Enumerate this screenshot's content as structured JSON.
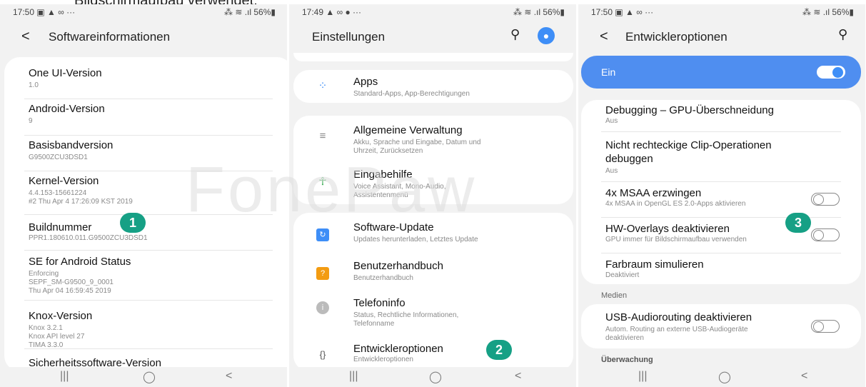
{
  "caption": "Bildschirmaufbau verwendet.",
  "watermark": "FonePaw",
  "panel1": {
    "status_left": "17:50 ▣ ▲ ∞ ···",
    "status_right": "⁂ ≋ .ıl 56%▮",
    "title": "Softwareinformationen",
    "items": [
      {
        "title": "One UI-Version",
        "sub": "1.0"
      },
      {
        "title": "Android-Version",
        "sub": "9"
      },
      {
        "title": "Basisbandversion",
        "sub": "G9500ZCU3DSD1"
      },
      {
        "title": "Kernel-Version",
        "sub": "4.4.153-15661224\n#2 Thu Apr 4 17:26:09 KST 2019"
      },
      {
        "title": "Buildnummer",
        "sub": "PPR1.180610.011.G9500ZCU3DSD1"
      },
      {
        "title": "SE for Android Status",
        "sub": "Enforcing\nSEPF_SM-G9500_9_0001\nThu Apr 04 16:59:45 2019"
      },
      {
        "title": "Knox-Version",
        "sub": "Knox 3.2.1\nKnox API level 27\nTIMA 3.3.0"
      },
      {
        "title": "Sicherheitssoftware-Version",
        "sub": ""
      }
    ],
    "badge": "1"
  },
  "panel2": {
    "status_left": "17:49 ▲ ∞ ● ···",
    "status_right": "⁂ ≋ .ıl 56%▮",
    "title": "Einstellungen",
    "items": [
      {
        "title": "Apps",
        "sub": "Standard-Apps, App-Berechtigungen",
        "icon": "apps-icon"
      },
      {
        "title": "Allgemeine Verwaltung",
        "sub": "Akku, Sprache und Eingabe, Datum und\nUhrzeit, Zurücksetzen",
        "icon": "sliders-icon"
      },
      {
        "title": "Eingabehilfe",
        "sub": "Voice Assistant, Mono-Audio,\nAssistentenmenü",
        "icon": "accessibility-icon"
      },
      {
        "title": "Software-Update",
        "sub": "Updates herunterladen, Letztes Update",
        "icon": "update-icon"
      },
      {
        "title": "Benutzerhandbuch",
        "sub": "Benutzerhandbuch",
        "icon": "help-icon"
      },
      {
        "title": "Telefoninfo",
        "sub": "Status, Rechtliche Informationen,\nTelefonname",
        "icon": "info-icon"
      },
      {
        "title": "Entwickleroptionen",
        "sub": "Entwickleroptionen",
        "icon": "braces-icon"
      }
    ],
    "badge": "2"
  },
  "panel3": {
    "status_left": "17:50 ▣ ▲ ∞ ···",
    "status_right": "⁂ ≋ .ıl 56%▮",
    "title": "Entwickleroptionen",
    "master_label": "Ein",
    "items": [
      {
        "title": "Debugging – GPU-Überschneidung",
        "sub": "Aus"
      },
      {
        "title": "Nicht rechteckige Clip-Operationen\ndebuggen",
        "sub": "Aus"
      },
      {
        "title": "4x MSAA erzwingen",
        "sub": "4x MSAA in OpenGL ES 2.0-Apps aktivieren"
      },
      {
        "title": "HW-Overlays deaktivieren",
        "sub": "GPU immer für Bildschirmaufbau verwenden"
      },
      {
        "title": "Farbraum simulieren",
        "sub": "Deaktiviert"
      }
    ],
    "section_medien": "Medien",
    "usb": {
      "title": "USB-Audiorouting deaktivieren",
      "sub": "Autom. Routing an externe USB-Audiogeräte\ndeaktivieren"
    },
    "section_ueberwachung": "Überwachung",
    "badge": "3"
  },
  "nav": {
    "recent": "|||",
    "home": "◯",
    "back": "<"
  },
  "colors": {
    "accent": "#3e8ef7",
    "badge": "#16a085",
    "background": "#f2f2f2"
  }
}
